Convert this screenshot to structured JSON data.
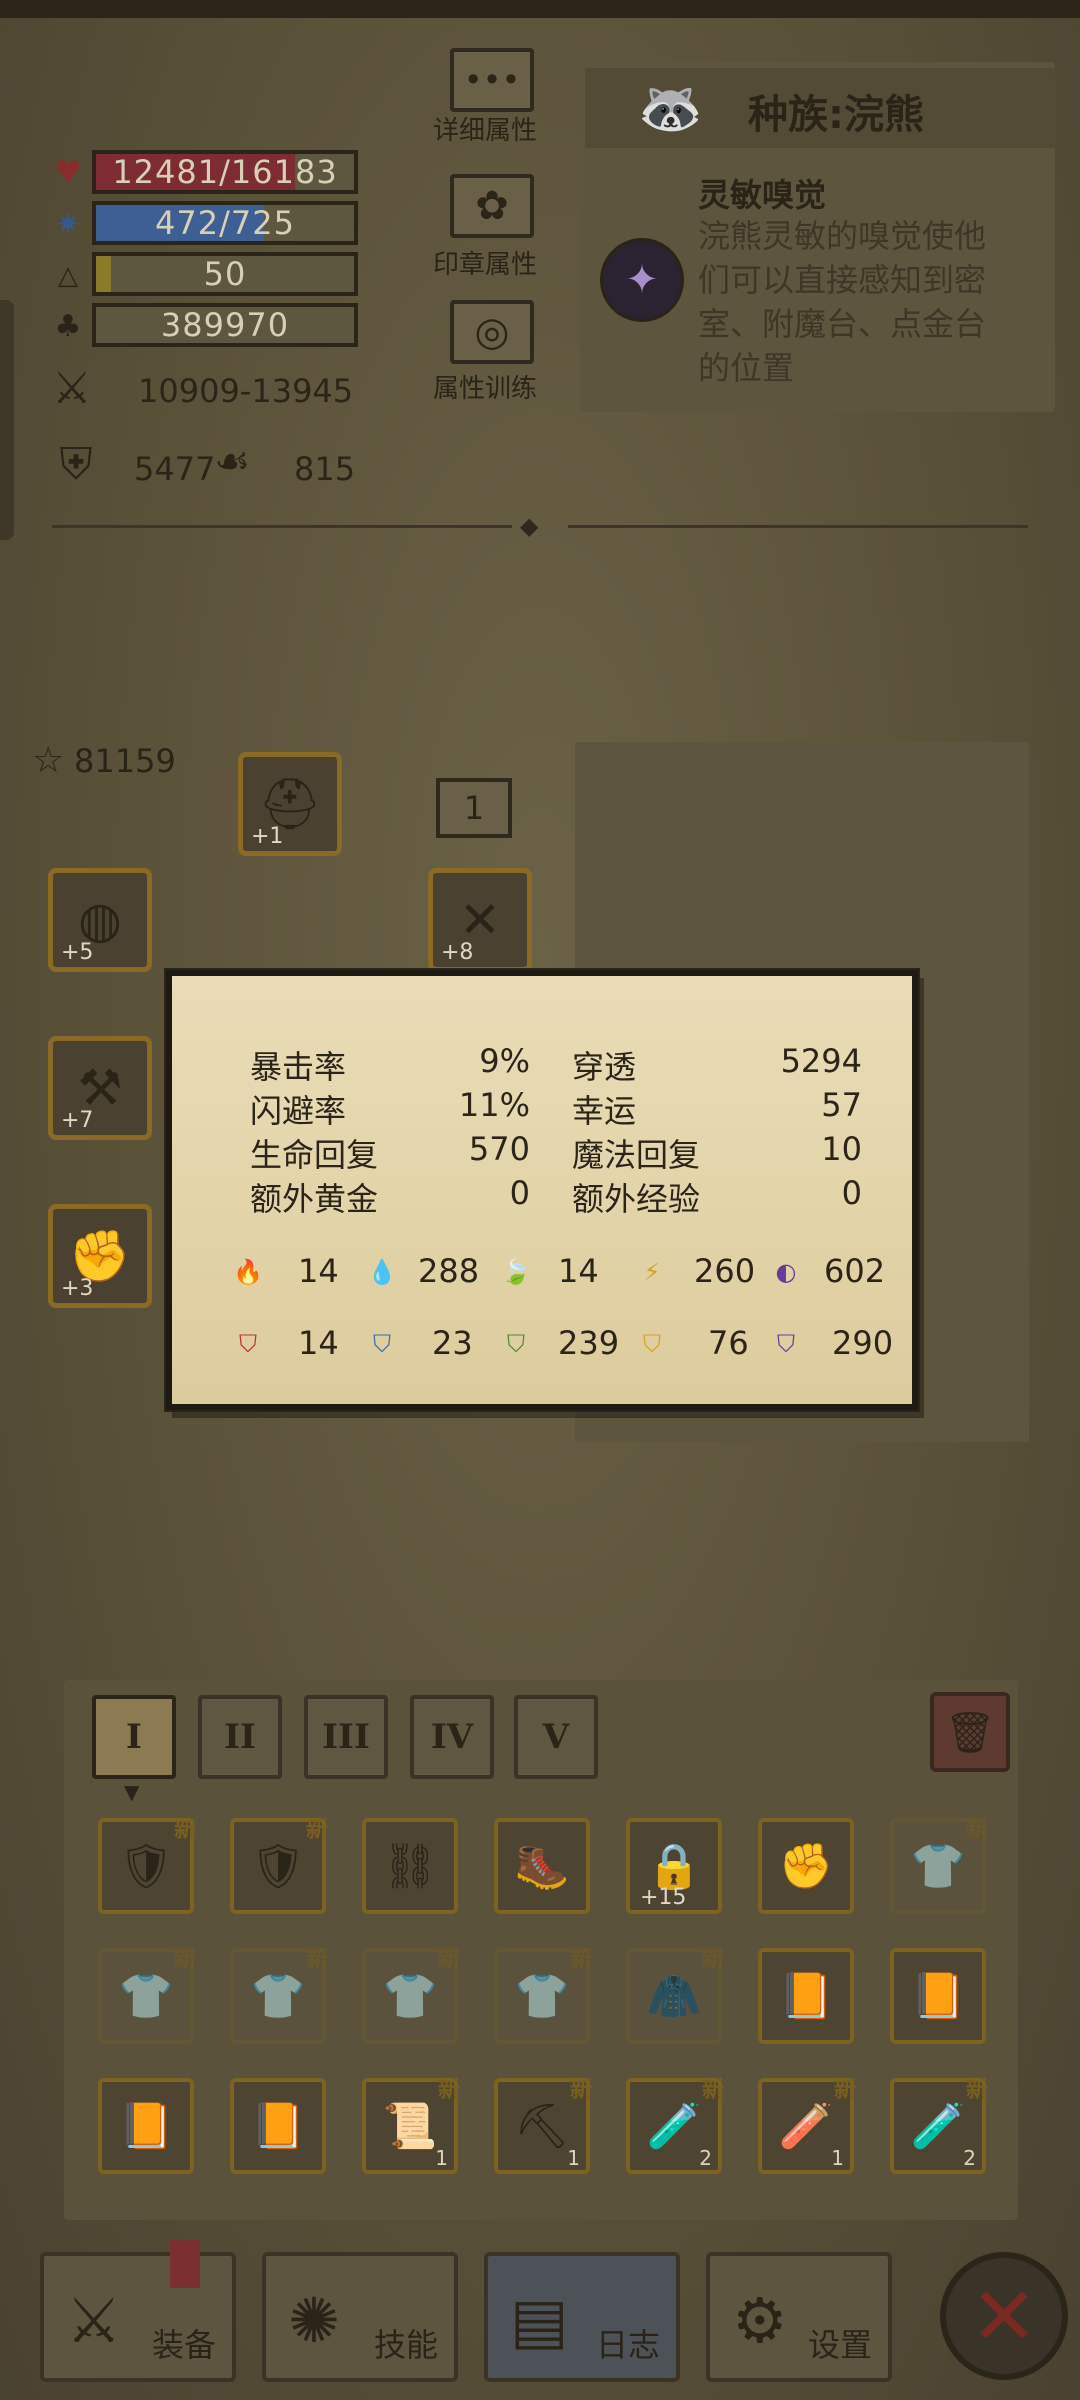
{
  "hero": {
    "hp": "12481/16183",
    "hp_fill": 0.77,
    "mp": "472/725",
    "mp_fill": 0.65,
    "level": "50",
    "xp_fill": 0.06,
    "gold": "389970",
    "attack": "10909-13945",
    "armor": "5477",
    "magic_resist": "815",
    "power": "81159",
    "colors": {
      "hp": "#7e2c33",
      "mp": "#3d5f93",
      "xp": "#8a7b2a"
    }
  },
  "side_menu": [
    {
      "label": "详细属性",
      "icon": "dots-icon"
    },
    {
      "label": "印章属性",
      "icon": "seal-icon"
    },
    {
      "label": "属性训练",
      "icon": "target-icon"
    }
  ],
  "race": {
    "title": "种族:浣熊",
    "trait_name": "灵敏嗅觉",
    "trait_desc_lines": [
      "浣熊灵敏的嗅觉使他",
      "们可以直接感知到密",
      "室、附魔台、点金台",
      "的位置"
    ]
  },
  "equipment": {
    "badge": "1",
    "slots": [
      {
        "name": "helmet",
        "icon": "helmet-icon",
        "plus": "+1"
      },
      {
        "name": "amulet",
        "icon": "necklace-icon",
        "plus": "+5"
      },
      {
        "name": "shoulder",
        "icon": "shoulder-icon",
        "plus": "+8"
      },
      {
        "name": "weapon",
        "icon": "hammer-icon",
        "plus": "+7"
      },
      {
        "name": "gauntlet",
        "icon": "gauntlet-icon",
        "plus": "+3"
      }
    ]
  },
  "popup": {
    "left_stats": [
      {
        "label": "暴击率",
        "value": "9%"
      },
      {
        "label": "闪避率",
        "value": "11%"
      },
      {
        "label": "生命回复",
        "value": "570"
      },
      {
        "label": "额外黄金",
        "value": "0"
      }
    ],
    "right_stats": [
      {
        "label": "穿透",
        "value": "5294"
      },
      {
        "label": "幸运",
        "value": "57"
      },
      {
        "label": "魔法回复",
        "value": "10"
      },
      {
        "label": "额外经验",
        "value": "0"
      }
    ],
    "attack_elements": [
      {
        "icon": "fire-icon",
        "value": "14",
        "color": "#c0302a"
      },
      {
        "icon": "water-icon",
        "value": "288",
        "color": "#2d6fb0"
      },
      {
        "icon": "leaf-icon",
        "value": "14",
        "color": "#4f8a2e"
      },
      {
        "icon": "lightning-icon",
        "value": "260",
        "color": "#d4a21e"
      },
      {
        "icon": "arcane-icon",
        "value": "602",
        "color": "#6a3a9a"
      }
    ],
    "resist_elements": [
      {
        "icon": "fire-shield-icon",
        "value": "14",
        "color": "#c0302a"
      },
      {
        "icon": "water-shield-icon",
        "value": "23",
        "color": "#2d6fb0"
      },
      {
        "icon": "leaf-shield-icon",
        "value": "239",
        "color": "#4f8a2e"
      },
      {
        "icon": "lightning-shield-icon",
        "value": "76",
        "color": "#d4a21e"
      },
      {
        "icon": "arcane-shield-icon",
        "value": "290",
        "color": "#6a3a9a"
      }
    ]
  },
  "inventory": {
    "tabs": [
      "I",
      "II",
      "III",
      "IV",
      "V"
    ],
    "active_tab": "I",
    "new_label": "新",
    "items": [
      {
        "icon": "armor-icon",
        "new": true,
        "count": ""
      },
      {
        "icon": "armor-icon",
        "new": true,
        "count": ""
      },
      {
        "icon": "leg-armor-icon",
        "new": false,
        "count": ""
      },
      {
        "icon": "boots-icon",
        "new": false,
        "count": ""
      },
      {
        "icon": "locked-item-icon",
        "new": false,
        "count": "",
        "plus": "+15"
      },
      {
        "icon": "gauntlet-icon",
        "new": false,
        "count": ""
      },
      {
        "icon": "shirt-icon",
        "new": true,
        "count": "",
        "faded": true
      },
      {
        "icon": "shirt-icon",
        "new": true,
        "count": "",
        "faded": true
      },
      {
        "icon": "shirt-icon",
        "new": true,
        "count": "",
        "faded": true
      },
      {
        "icon": "shirt-icon",
        "new": true,
        "count": "",
        "faded": true
      },
      {
        "icon": "shirt-icon",
        "new": true,
        "count": "",
        "faded": true
      },
      {
        "icon": "hood-icon",
        "new": true,
        "count": "",
        "faded": true
      },
      {
        "icon": "book-icon",
        "new": false,
        "count": ""
      },
      {
        "icon": "book-icon",
        "new": false,
        "count": ""
      },
      {
        "icon": "book-icon",
        "new": false,
        "count": ""
      },
      {
        "icon": "book-icon",
        "new": false,
        "count": ""
      },
      {
        "icon": "scroll-icon",
        "new": true,
        "count": "1"
      },
      {
        "icon": "pickaxe-icon",
        "new": true,
        "count": "1"
      },
      {
        "icon": "red-potion-icon",
        "new": true,
        "count": "2"
      },
      {
        "icon": "blue-potion-icon",
        "new": true,
        "count": "1"
      },
      {
        "icon": "red-potion-icon",
        "new": true,
        "count": "2"
      }
    ]
  },
  "nav": [
    {
      "label": "装备",
      "icon": "axe-icon"
    },
    {
      "label": "技能",
      "icon": "skill-icon"
    },
    {
      "label": "日志",
      "icon": "journal-icon"
    },
    {
      "label": "设置",
      "icon": "gear-icon"
    }
  ]
}
